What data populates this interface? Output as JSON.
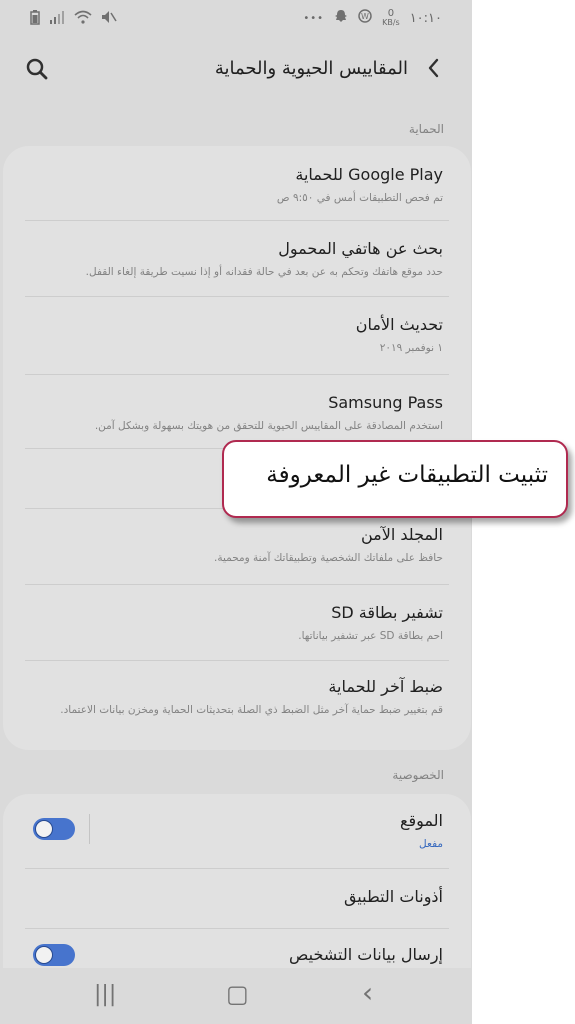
{
  "status_bar": {
    "time": "١٠:١٠",
    "data_speed_top": "0",
    "data_speed_unit": "KB/s",
    "more_dots": "•••"
  },
  "header": {
    "title": "المقاييس الحيوية والحماية"
  },
  "sections": {
    "security_label": "الحماية",
    "privacy_label": "الخصوصية"
  },
  "security_items": [
    {
      "title": "Google Play للحماية",
      "subtitle": "تم فحص التطبيقات أمس في ٩:٥٠ ص"
    },
    {
      "title": "بحث عن هاتفي المحمول",
      "subtitle": "حدد موقع هاتفك وتحكم به عن بعد في حالة فقدانه أو إذا نسيت طريقة إلغاء القفل."
    },
    {
      "title": "تحديث الأمان",
      "subtitle": "١ نوفمبر ٢٠١٩"
    },
    {
      "title": "Samsung Pass",
      "subtitle": "استخدم المصادقة على المقاييس الحيوية للتحقق من هويتك بسهولة وبشكل آمن."
    },
    {
      "title": "المجلد الآمن",
      "subtitle": "حافظ على ملفاتك الشخصية وتطبيقاتك آمنة ومحمية."
    },
    {
      "title": "تشفير بطاقة SD",
      "subtitle": "احم بطاقة SD عبر تشفير بياناتها."
    },
    {
      "title": "ضبط آخر للحماية",
      "subtitle": "قم بتغيير ضبط حماية آخر مثل الضبط ذي الصلة بتحديثات الحماية ومخزن بيانات الاعتماد."
    }
  ],
  "privacy_items": [
    {
      "title": "الموقع",
      "subtitle": "مفعل",
      "toggle": true
    },
    {
      "title": "أذونات التطبيق"
    },
    {
      "title": "إرسال بيانات التشخيص",
      "toggle": true
    }
  ],
  "callout": {
    "text": "تثبيت التطبيقات غير المعروفة"
  },
  "nav": {
    "recents": "|||",
    "home": "▢",
    "back": "‹"
  },
  "colors": {
    "accent": "#4b7bd8",
    "callout_border": "#b02a50",
    "status_enabled": "#3a6fc9"
  }
}
